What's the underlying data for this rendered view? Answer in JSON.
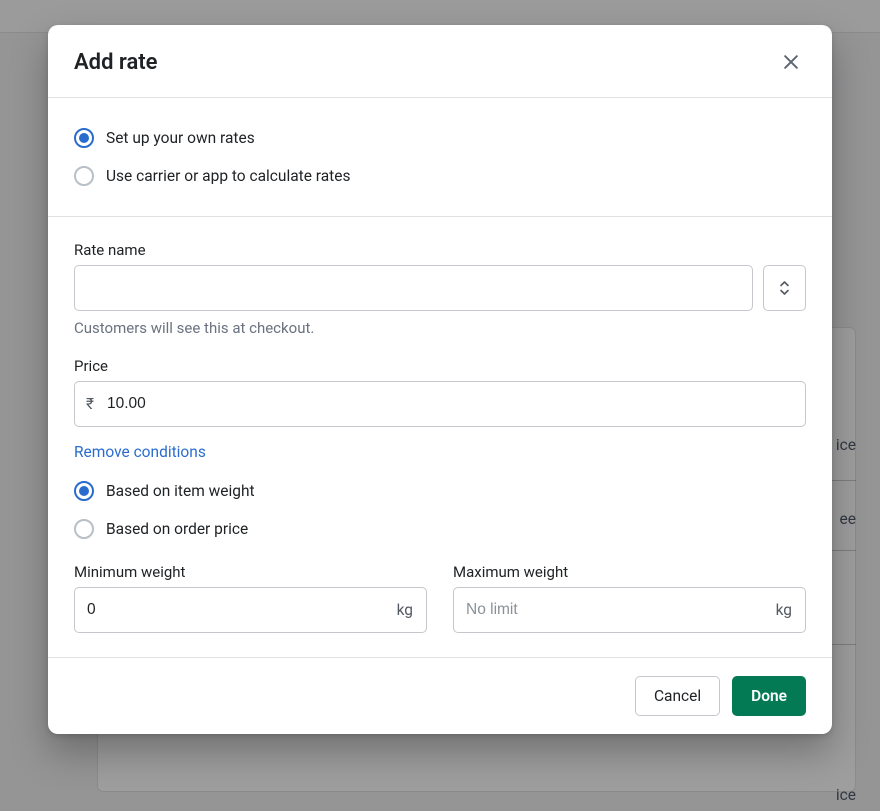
{
  "modal": {
    "title": "Add rate",
    "rate_type": {
      "own_label": "Set up your own rates",
      "carrier_label": "Use carrier or app to calculate rates",
      "selected": "own"
    },
    "rate_name": {
      "label": "Rate name",
      "value": "",
      "help": "Customers will see this at checkout."
    },
    "price": {
      "label": "Price",
      "currency_symbol": "₹",
      "value": "10.00"
    },
    "conditions": {
      "remove_link": "Remove conditions",
      "basis": {
        "weight_label": "Based on item weight",
        "price_label": "Based on order price",
        "selected": "weight"
      },
      "min_weight": {
        "label": "Minimum weight",
        "value": "0",
        "unit": "kg"
      },
      "max_weight": {
        "label": "Maximum weight",
        "value": "",
        "placeholder": "No limit",
        "unit": "kg"
      }
    },
    "footer": {
      "cancel": "Cancel",
      "done": "Done"
    }
  },
  "background_hints": {
    "word1": "ice",
    "word2": "ee",
    "word3": "ice"
  }
}
